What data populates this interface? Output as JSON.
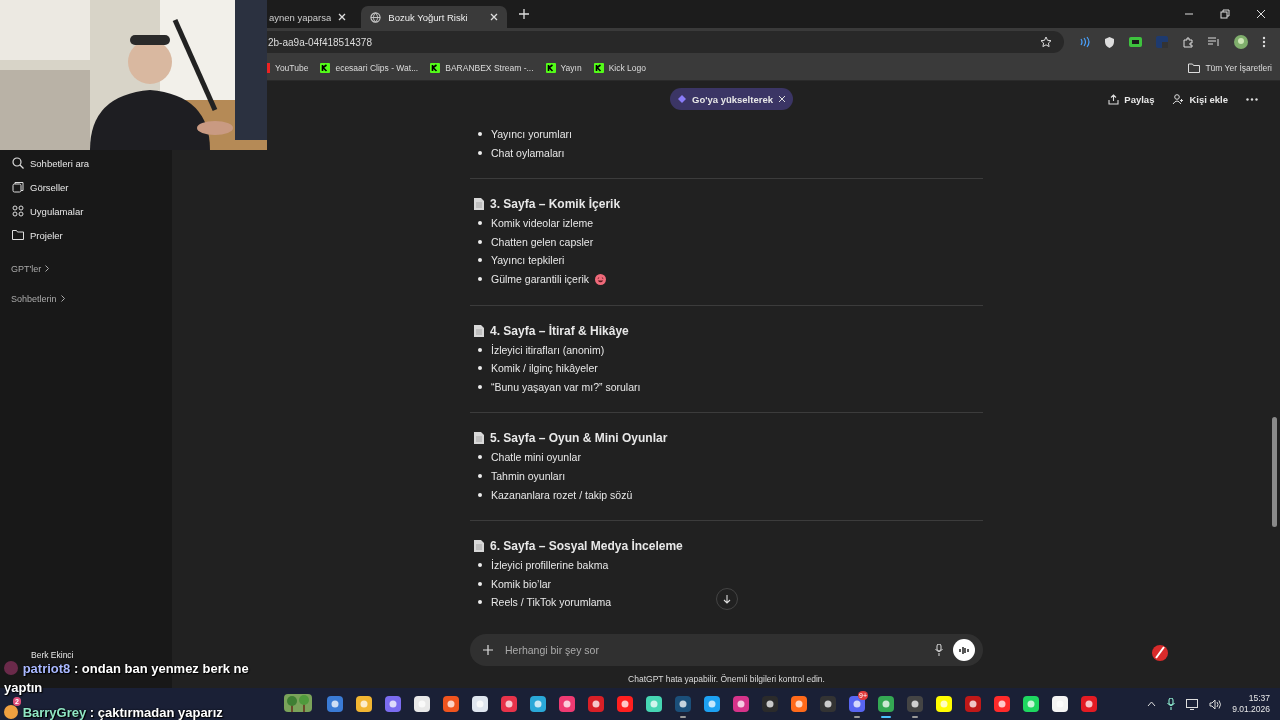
{
  "browser": {
    "tabs": [
      {
        "title": "aynen yaparsa",
        "selected": false
      },
      {
        "title": "Bozuk Yoğurt Riski",
        "selected": true
      }
    ],
    "address": "2b-aa9a-04f418514378",
    "bookmarks": [
      {
        "title": "YouTube"
      },
      {
        "title": "ecesaari Clips - Wat..."
      },
      {
        "title": "BARANBEX Stream -..."
      },
      {
        "title": "Yayın"
      },
      {
        "title": "Kick Logo"
      }
    ],
    "all_bookmarks": "Tüm Yer İşaretleri"
  },
  "sidebar": {
    "items": [
      {
        "label": "Sohbetleri ara"
      },
      {
        "label": "Görseller"
      },
      {
        "label": "Uygulamalar"
      },
      {
        "label": "Projeler"
      }
    ],
    "groups": [
      {
        "label": "GPT'ler"
      },
      {
        "label": "Sohbetlerin"
      }
    ],
    "user": {
      "name": "Berk Ekinci"
    }
  },
  "header": {
    "upgrade": "Go'ya yükselterek",
    "share": "Paylaş",
    "add_person": "Kişi ekle"
  },
  "sections": [
    {
      "items": [
        {
          "text": "Yayıncı yorumları"
        },
        {
          "text": "Chat oylamaları"
        }
      ]
    },
    {
      "title": "3. Sayfa – Komik İçerik",
      "items": [
        {
          "text": "Komik videolar izleme"
        },
        {
          "text": "Chatten gelen capsler"
        },
        {
          "text": "Yayıncı tepkileri"
        },
        {
          "text": "Gülme garantili içerik",
          "emoji": true
        }
      ]
    },
    {
      "title": "4. Sayfa – İtiraf & Hikâye",
      "items": [
        {
          "text": "İzleyici itirafları (anonim)"
        },
        {
          "text": "Komik / ilginç hikâyeler"
        },
        {
          "text": "“Bunu yaşayan var mı?” soruları"
        }
      ]
    },
    {
      "title": "5. Sayfa – Oyun & Mini Oyunlar",
      "items": [
        {
          "text": "Chatle mini oyunlar"
        },
        {
          "text": "Tahmin oyunları"
        },
        {
          "text": "Kazananlara rozet / takip sözü"
        }
      ]
    },
    {
      "title": "6. Sayfa – Sosyal Medya İnceleme",
      "items": [
        {
          "text": "İzleyici profillerine bakma"
        },
        {
          "text": "Komik bio’lar"
        },
        {
          "text": "Reels / TikTok yorumlama"
        }
      ]
    }
  ],
  "composer": {
    "placeholder": "Herhangi bir şey sor"
  },
  "disclaimer": "ChatGPT hata yapabilir. Önemli bilgileri kontrol edin.",
  "stream_chat": [
    {
      "user": "patriot8",
      "color": "#a9b8ff",
      "message": ": ondan ban yenmez berk ne yaptın"
    },
    {
      "user": "BarryGrey",
      "color": "#8fe6c4",
      "message": ": çaktırmadan yaparız",
      "badge": "2"
    }
  ],
  "taskbar": {
    "apps": [
      {
        "color": "#3a7bd5",
        "running": false
      },
      {
        "color": "#f2b632",
        "running": false
      },
      {
        "color": "#7b6cf0",
        "running": false
      },
      {
        "color": "#e8e8e8",
        "running": false
      },
      {
        "color": "#f0541e",
        "running": false
      },
      {
        "color": "#dfe6ef",
        "running": false
      },
      {
        "color": "#e8334a",
        "running": false
      },
      {
        "color": "#2aa8d8",
        "running": false
      },
      {
        "color": "#ef3a72",
        "running": false
      },
      {
        "color": "#d81f26",
        "running": false
      },
      {
        "color": "#ff1f1f",
        "running": false
      },
      {
        "color": "#46d6b3",
        "running": false
      },
      {
        "color": "#1b4f7a",
        "running": true
      },
      {
        "color": "#1da1f2",
        "running": false
      },
      {
        "color": "#d6338a",
        "running": false
      },
      {
        "color": "#2b2b2b",
        "running": false
      },
      {
        "color": "#ff6a1a",
        "running": false
      },
      {
        "color": "#333333",
        "running": false
      },
      {
        "color": "#5865f2",
        "running": true,
        "badge": "9+"
      },
      {
        "color": "#34a853",
        "running": true,
        "selected": true
      },
      {
        "color": "#444444",
        "running": true
      },
      {
        "color": "#fffc00",
        "running": false
      },
      {
        "color": "#c01818",
        "running": false
      },
      {
        "color": "#ff2a2a",
        "running": false
      },
      {
        "color": "#1ed760",
        "running": false
      },
      {
        "color": "#f4f4f4",
        "running": false
      },
      {
        "color": "#e31b23",
        "running": false
      }
    ],
    "time": "15:37",
    "date": "9.01.2026"
  }
}
